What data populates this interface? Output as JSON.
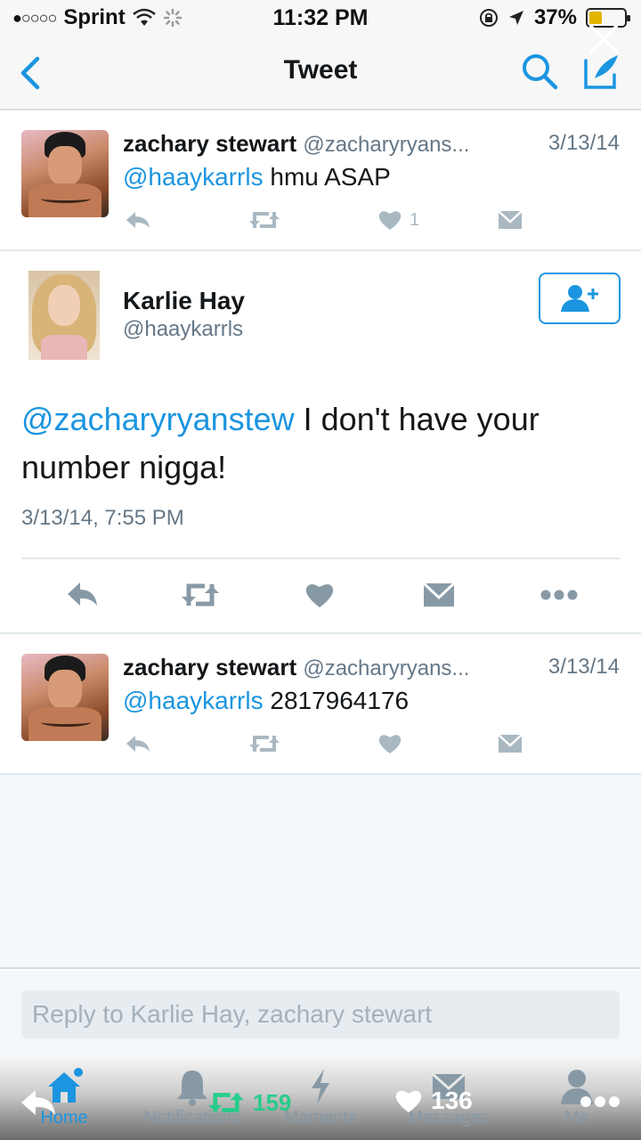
{
  "status_bar": {
    "signal": "●○○○○",
    "carrier": "Sprint",
    "time": "11:32 PM",
    "battery": "37%",
    "battery_level": 0.37
  },
  "nav": {
    "title": "Tweet"
  },
  "tweets": [
    {
      "name": "zachary stewart",
      "handle": "@zacharyryans...",
      "date": "3/13/14",
      "mention": "@haaykarrls",
      "text": " hmu ASAP",
      "likes": "1"
    },
    {
      "name": "zachary stewart",
      "handle": "@zacharyryans...",
      "date": "3/13/14",
      "mention": "@haaykarrls",
      "text": " 2817964176",
      "likes": ""
    }
  ],
  "main_tweet": {
    "name": "Karlie Hay",
    "handle": "@haaykarrls",
    "mention": "@zacharyryanstew",
    "text": " I don't have your number nigga!",
    "timestamp": "3/13/14, 7:55 PM"
  },
  "reply": {
    "placeholder": "Reply to Karlie Hay, zachary stewart"
  },
  "tabs": [
    {
      "label": "Home",
      "icon": "home-icon"
    },
    {
      "label": "Notifications",
      "icon": "bell-icon"
    },
    {
      "label": "Moments",
      "icon": "lightning-icon"
    },
    {
      "label": "Messages",
      "icon": "envelope-icon"
    },
    {
      "label": "Me",
      "icon": "person-icon"
    }
  ],
  "overlay": {
    "retweet_count": "159",
    "like_count": "136"
  },
  "colors": {
    "accent": "#1b95e0",
    "muted": "#aab8c2",
    "retweet": "#19cf86"
  }
}
